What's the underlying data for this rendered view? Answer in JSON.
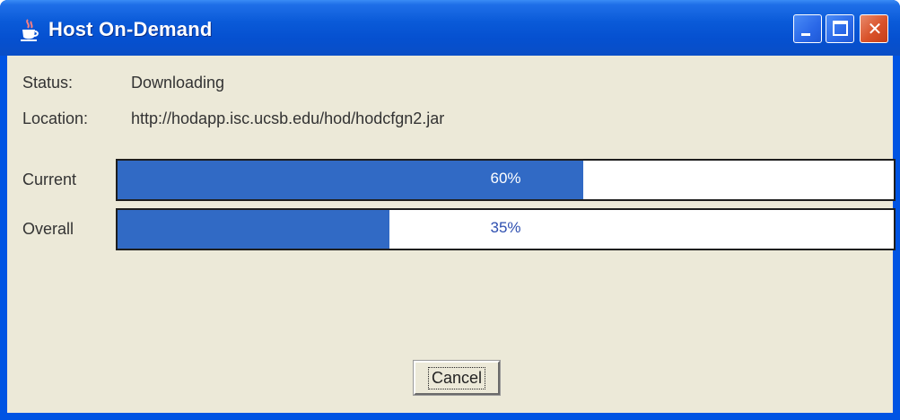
{
  "window": {
    "title": "Host On-Demand",
    "icon": "java-coffee-cup-icon",
    "controls": {
      "minimize": "minimize-icon",
      "maximize": "maximize-icon",
      "close_glyph": "✕"
    }
  },
  "fields": {
    "status_label": "Status:",
    "status_value": "Downloading",
    "location_label": "Location:",
    "location_value": "http://hodapp.isc.ucsb.edu/hod/hodcfgn2.jar"
  },
  "progress": {
    "current": {
      "label": "Current",
      "value": 0.6,
      "text": "60%"
    },
    "overall": {
      "label": "Overall",
      "value": 0.35,
      "text": "35%"
    }
  },
  "buttons": {
    "cancel_label": "Cancel"
  },
  "colors": {
    "titlebar": "#0a5ad8",
    "progress_fill": "#316ac5",
    "client_bg": "#ece9d8",
    "close_button": "#d9522a"
  }
}
